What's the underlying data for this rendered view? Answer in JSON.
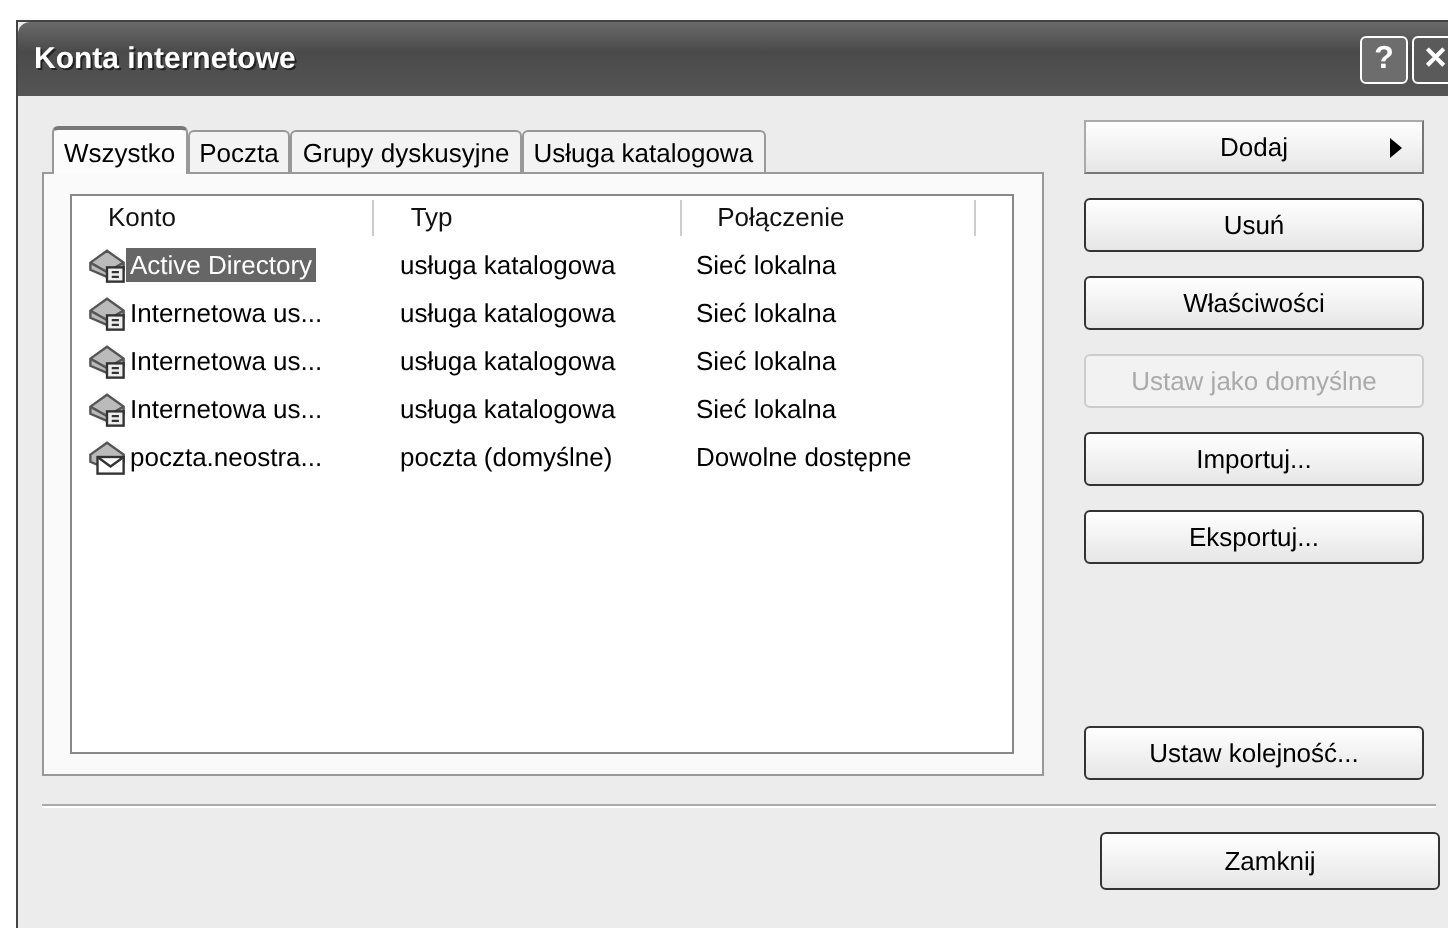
{
  "window": {
    "title": "Konta internetowe",
    "controls": [
      {
        "kind": "help",
        "label": "?"
      },
      {
        "kind": "close",
        "label": "✕"
      }
    ]
  },
  "tabs": [
    {
      "label": "Wszystko",
      "selected": true
    },
    {
      "label": "Poczta",
      "selected": false
    },
    {
      "label": "Grupy dyskusyjne",
      "selected": false
    },
    {
      "label": "Usługa katalogowa",
      "selected": false
    }
  ],
  "table": {
    "columns": [
      "Konto",
      "Typ",
      "Połączenie"
    ],
    "rows": [
      {
        "kind": "directory",
        "account": "Active Directory",
        "type": "usługa katalogowa",
        "connection": "Sieć lokalna",
        "selected": true
      },
      {
        "kind": "directory",
        "account": "Internetowa us...",
        "type": "usługa katalogowa",
        "connection": "Sieć lokalna",
        "selected": false
      },
      {
        "kind": "directory",
        "account": "Internetowa us...",
        "type": "usługa katalogowa",
        "connection": "Sieć lokalna",
        "selected": false
      },
      {
        "kind": "directory",
        "account": "Internetowa us...",
        "type": "usługa katalogowa",
        "connection": "Sieć lokalna",
        "selected": false
      },
      {
        "kind": "mail",
        "account": "poczta.neostra...",
        "type": "poczta (domyślne)",
        "connection": "Dowolne dostępne",
        "selected": false
      }
    ]
  },
  "side_buttons": [
    {
      "kind": "menu",
      "label": "Dodaj",
      "disabled": false
    },
    {
      "kind": "push",
      "label": "Usuń",
      "disabled": false
    },
    {
      "kind": "push",
      "label": "Właściwości",
      "disabled": false
    },
    {
      "kind": "push",
      "label": "Ustaw jako domyślne",
      "disabled": true
    },
    {
      "kind": "push",
      "label": "Importuj...",
      "disabled": false
    },
    {
      "kind": "push",
      "label": "Eksportuj...",
      "disabled": false
    },
    {
      "kind": "bottom",
      "label": "Ustaw kolejność...",
      "disabled": false
    }
  ],
  "close_button": {
    "label": "Zamknij"
  }
}
